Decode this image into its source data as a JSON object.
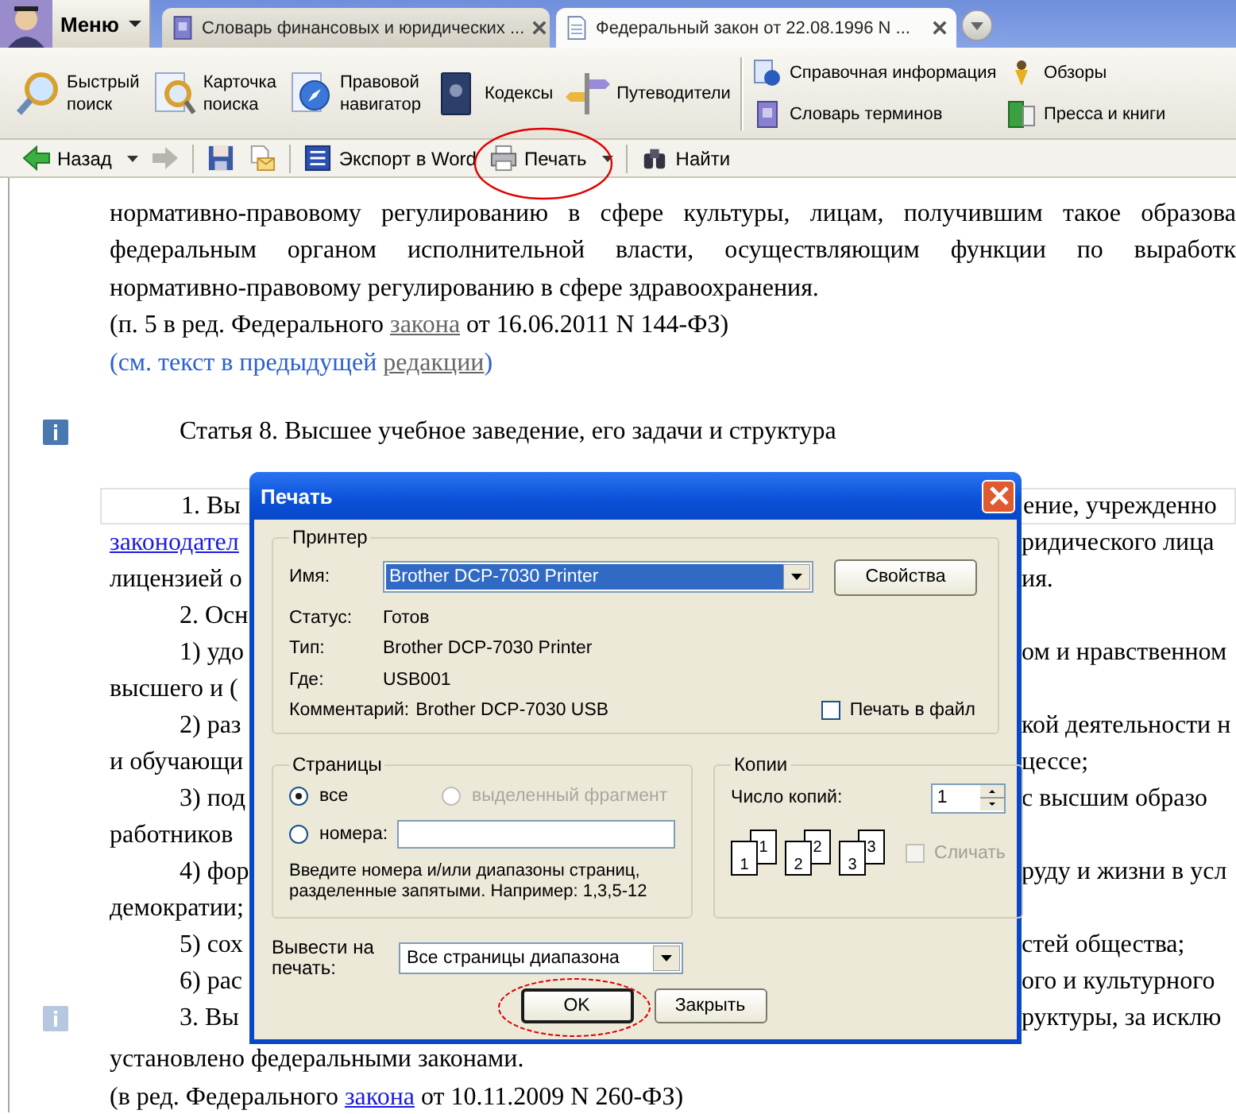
{
  "tabs_bar": {
    "menu_label": "Меню",
    "tabs": [
      {
        "kind": "dictionary",
        "label": "Словарь финансовых и юридических ...",
        "selected": false
      },
      {
        "kind": "document",
        "label": "Федеральный закон от 22.08.1996 N ...",
        "selected": true
      }
    ]
  },
  "main_toolbar": {
    "buttons": [
      {
        "kind": "search",
        "lines": [
          "Быстрый",
          "поиск"
        ]
      },
      {
        "kind": "card",
        "lines": [
          "Карточка",
          "поиска"
        ]
      },
      {
        "kind": "navigator",
        "lines": [
          "Правовой",
          "навигатор"
        ]
      },
      {
        "kind": "codes",
        "lines": [
          "Кодексы"
        ]
      },
      {
        "kind": "guide",
        "lines": [
          "Путеводители"
        ]
      }
    ],
    "links": [
      {
        "kind": "info",
        "label": "Справочная информация"
      },
      {
        "kind": "reviews",
        "label": "Обзоры"
      },
      {
        "kind": "dictionary",
        "label": "Словарь терминов"
      },
      {
        "kind": "press",
        "label": "Пресса и книги"
      }
    ]
  },
  "nav_toolbar": {
    "groups": [
      [
        {
          "kind": "back",
          "label": "Назад",
          "dropdown": true,
          "disabled": false,
          "highlighted": false
        },
        {
          "kind": "forward",
          "dropdown": false,
          "disabled": true,
          "highlighted": false
        }
      ],
      [
        {
          "kind": "save",
          "dropdown": false,
          "disabled": false,
          "highlighted": false
        },
        {
          "kind": "mail",
          "dropdown": false,
          "disabled": false,
          "highlighted": false
        }
      ],
      [
        {
          "kind": "word",
          "label": "Экспорт в Word",
          "dropdown": false,
          "disabled": false,
          "highlighted": false
        },
        {
          "kind": "print",
          "label": "Печать",
          "dropdown": true,
          "disabled": false,
          "highlighted": true
        }
      ],
      [
        {
          "kind": "find",
          "label": "Найти",
          "dropdown": false,
          "disabled": false,
          "highlighted": false
        }
      ]
    ]
  },
  "document": {
    "top_lines": [
      {
        "kind": "justified",
        "segments": [
          {
            "text": "нормативно-правовому регулированию в сфере культуры, лицам, получившим такое образова"
          }
        ]
      },
      {
        "kind": "justified",
        "segments": [
          {
            "text": "федеральным органом исполнительной власти, осуществляющим функции по выработк"
          }
        ]
      },
      {
        "kind": "plain",
        "segments": [
          {
            "text": "нормативно-правовому регулированию в сфере здравоохранения."
          }
        ]
      },
      {
        "kind": "plain",
        "segments": [
          {
            "text": "(п. 5 в ред. Федерального "
          },
          {
            "text": "закона",
            "link": true,
            "visited": true
          },
          {
            "text": " от 16.06.2011 N 144-ФЗ)"
          }
        ]
      },
      {
        "kind": "note",
        "segments": [
          {
            "text": "(см. текст в предыдущей "
          },
          {
            "text": "редакции",
            "link": true,
            "visited": true
          },
          {
            "text": ")"
          }
        ]
      }
    ],
    "article": {
      "title": "Статья 8. Высшее учебное заведение, его задачи и структура",
      "info_marker": {
        "dimmed": false
      }
    },
    "rows": [
      {
        "kind": "paragraph_start",
        "framed": true,
        "left": [
          {
            "text": "1.  Вы"
          }
        ],
        "right": "ение,  учрежденно"
      },
      {
        "kind": "continuation",
        "framed": false,
        "left": [
          {
            "text": "законодател",
            "link": true,
            "visited": false
          }
        ],
        "right": "ридического  лица"
      },
      {
        "kind": "continuation",
        "framed": false,
        "left": [
          {
            "text": "лицензией о"
          }
        ],
        "right": "ия."
      },
      {
        "kind": "paragraph_start",
        "framed": false,
        "left": [
          {
            "text": "2. Осн"
          }
        ]
      },
      {
        "kind": "paragraph_start",
        "framed": false,
        "left": [
          {
            "text": "1) удо"
          }
        ],
        "right": "ом и нравственном"
      },
      {
        "kind": "continuation",
        "framed": false,
        "left": [
          {
            "text": "высшего и ("
          }
        ]
      },
      {
        "kind": "paragraph_start",
        "framed": false,
        "left": [
          {
            "text": "2) раз"
          }
        ],
        "right": "кой деятельности н"
      },
      {
        "kind": "continuation",
        "framed": false,
        "left": [
          {
            "text": "и обучающи"
          }
        ],
        "right": "цессе;"
      },
      {
        "kind": "paragraph_start",
        "framed": false,
        "left": [
          {
            "text": "3)  под"
          }
        ],
        "right": "с  высшим  образо"
      },
      {
        "kind": "continuation",
        "framed": false,
        "left": [
          {
            "text": "работников"
          }
        ]
      },
      {
        "kind": "paragraph_start",
        "framed": false,
        "left": [
          {
            "text": "4) фор"
          }
        ],
        "right": "руду и жизни в усл"
      },
      {
        "kind": "continuation",
        "framed": false,
        "left": [
          {
            "text": "демократии;"
          }
        ]
      },
      {
        "kind": "paragraph_start",
        "framed": false,
        "left": [
          {
            "text": "5) сох"
          }
        ],
        "right": "стей общества;"
      },
      {
        "kind": "paragraph_start",
        "framed": false,
        "left": [
          {
            "text": "6) рас"
          }
        ],
        "right": "ого и культурного"
      },
      {
        "kind": "paragraph_start",
        "framed": false,
        "left": [
          {
            "text": "3. Вы"
          }
        ],
        "right": "руктуры, за исклю",
        "info_marker": {
          "dimmed": true
        }
      }
    ],
    "bottom_lines": [
      {
        "kind": "plain",
        "segments": [
          {
            "text": "установлено федеральными законами."
          }
        ]
      },
      {
        "kind": "plain",
        "segments": [
          {
            "text": "(в ред. Федерального "
          },
          {
            "text": "закона",
            "link": true,
            "visited": false
          },
          {
            "text": " от 10.11.2009 N 260-ФЗ)"
          }
        ]
      }
    ]
  },
  "print_dialog": {
    "title": "Печать",
    "printer": {
      "legend": "Принтер",
      "name_label": "Имя:",
      "name_value": "Brother DCP-7030 Printer",
      "properties_button": "Свойства",
      "fields": [
        {
          "label": "Статус:",
          "value": "Готов"
        },
        {
          "label": "Тип:",
          "value": "Brother DCP-7030 Printer"
        },
        {
          "label": "Где:",
          "value": "USB001"
        },
        {
          "label": "Комментарий:",
          "value": "Brother DCP-7030 USB"
        }
      ],
      "print_to_file": {
        "label": "Печать в файл",
        "checked": false
      }
    },
    "pages": {
      "legend": "Страницы",
      "options": [
        {
          "label": "все",
          "selected": true,
          "disabled": false
        },
        {
          "label": "выделенный фрагмент",
          "selected": false,
          "disabled": true
        },
        {
          "label": "номера:",
          "selected": false,
          "disabled": false
        }
      ],
      "hint_lines": [
        "Введите номера и/или диапазоны страниц,",
        "разделенные запятыми. Например: 1,3,5-12"
      ]
    },
    "copies": {
      "legend": "Копии",
      "count_label": "Число копий:",
      "count_value": "1",
      "collate_sets": [
        [
          "1",
          "1"
        ],
        [
          "2",
          "2"
        ],
        [
          "3",
          "3"
        ]
      ],
      "collate": {
        "label": "Сличать",
        "checked": false,
        "disabled": true
      }
    },
    "print_what": {
      "label_lines": [
        "Вывести на",
        "печать:"
      ],
      "value": "Все страницы диапазона"
    },
    "buttons": [
      {
        "label": "OK",
        "highlighted": true
      },
      {
        "label": "Закрыть",
        "highlighted": false
      }
    ]
  }
}
